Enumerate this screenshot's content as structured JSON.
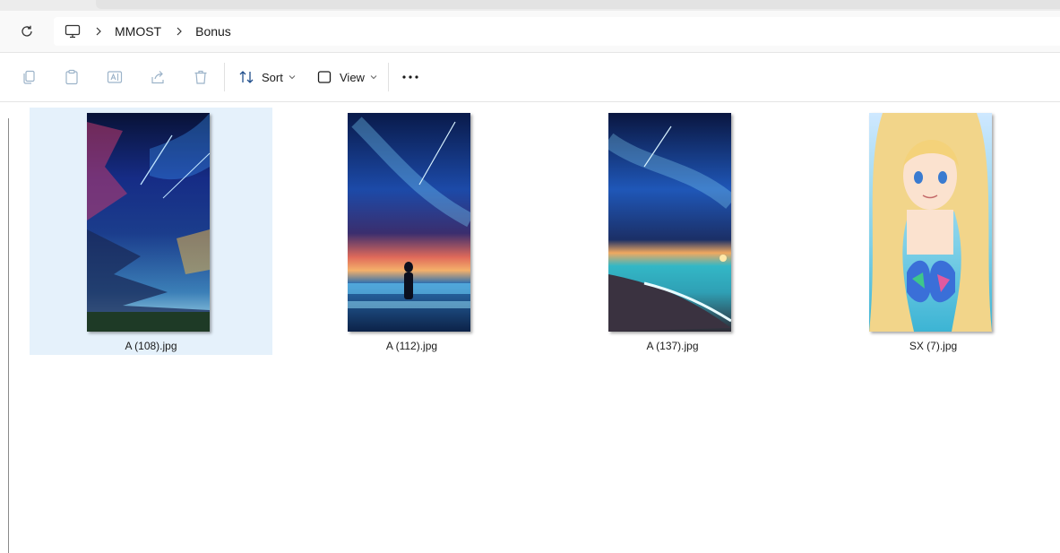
{
  "breadcrumb": {
    "items": [
      {
        "label": "MMOST"
      },
      {
        "label": "Bonus"
      }
    ]
  },
  "toolbar": {
    "sort_label": "Sort",
    "view_label": "View"
  },
  "icons": {
    "refresh": "refresh-icon",
    "computer": "computer-icon",
    "copy": "copy-icon",
    "paste": "paste-icon",
    "rename": "rename-icon",
    "share": "share-icon",
    "delete": "delete-icon",
    "sort": "sort-icon",
    "view": "view-icon",
    "more": "more-options-icon"
  },
  "files": [
    {
      "name": "A (108).jpg",
      "selected": true
    },
    {
      "name": "A (112).jpg",
      "selected": false
    },
    {
      "name": "A (137).jpg",
      "selected": false
    },
    {
      "name": "SX (7).jpg",
      "selected": false
    }
  ],
  "colors": {
    "selection": "#e5f1fb",
    "disabled_icon": "#9cb3c9",
    "text": "#1a1a1a"
  }
}
